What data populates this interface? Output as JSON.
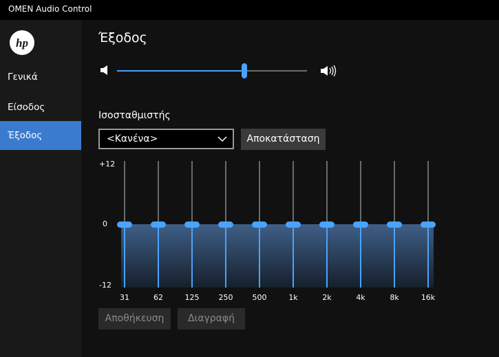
{
  "window": {
    "title": "OMEN Audio Control"
  },
  "sidebar": {
    "logo": "hp-logo",
    "items": [
      {
        "label": "Γενικά",
        "active": false
      },
      {
        "label": "Είσοδος",
        "active": false
      },
      {
        "label": "Έξοδος",
        "active": true
      }
    ]
  },
  "main": {
    "title": "Έξοδος",
    "volume": {
      "level": 0.67,
      "low_icon": "speaker-low-icon",
      "high_icon": "speaker-high-icon"
    },
    "equalizer": {
      "label": "Ισοσταθμιστής",
      "preset_value": "<Κανένα>",
      "reset_label": "Αποκατάσταση",
      "scale": {
        "max": "+12",
        "zero": "0",
        "min": "-12"
      },
      "bands": [
        {
          "freq": "31",
          "gain": 0
        },
        {
          "freq": "62",
          "gain": 0
        },
        {
          "freq": "125",
          "gain": 0
        },
        {
          "freq": "250",
          "gain": 0
        },
        {
          "freq": "500",
          "gain": 0
        },
        {
          "freq": "1k",
          "gain": 0
        },
        {
          "freq": "2k",
          "gain": 0
        },
        {
          "freq": "4k",
          "gain": 0
        },
        {
          "freq": "8k",
          "gain": 0
        },
        {
          "freq": "16k",
          "gain": 0
        }
      ],
      "save_label": "Αποθήκευση",
      "delete_label": "Διαγραφή"
    }
  },
  "colors": {
    "accent": "#4aa3ff",
    "active_nav": "#3a7bd0",
    "background": "#111111",
    "sidebar": "#191919"
  }
}
